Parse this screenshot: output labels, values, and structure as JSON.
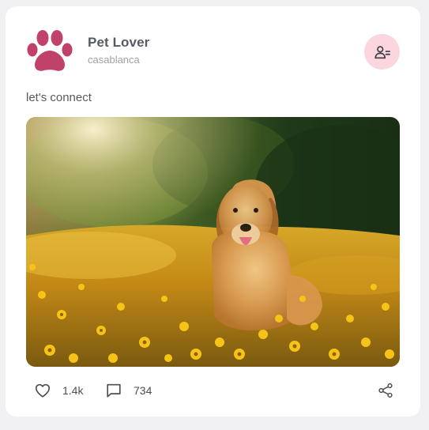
{
  "post": {
    "user": {
      "name": "Pet Lover",
      "location": "casablanca",
      "avatar_icon": "paw-icon",
      "avatar_color": "#c0416a"
    },
    "follow_button_icon": "remove-user-icon",
    "caption": "let's connect",
    "image_icon": "golden-retriever-photo"
  },
  "actions": {
    "like": {
      "icon": "heart-icon",
      "count": "1.4k"
    },
    "comment": {
      "icon": "comment-icon",
      "count": "734"
    },
    "share": {
      "icon": "share-icon"
    }
  },
  "colors": {
    "accent_pink": "#fbd6df",
    "paw": "#c0416a",
    "card_bg": "#ffffff",
    "page_bg": "#f1f1f3"
  }
}
